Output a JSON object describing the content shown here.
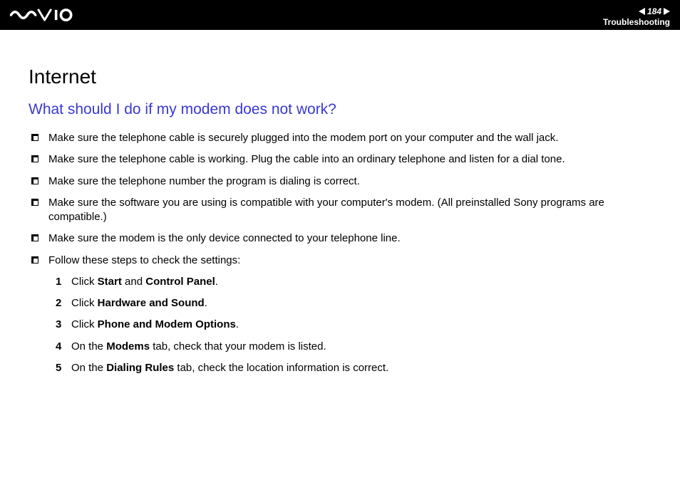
{
  "header": {
    "page_number": "184",
    "section": "Troubleshooting"
  },
  "content": {
    "heading": "Internet",
    "subheading": "What should I do if my modem does not work?",
    "bullets": [
      "Make sure the telephone cable is securely plugged into the modem port on your computer and the wall jack.",
      "Make sure the telephone cable is working. Plug the cable into an ordinary telephone and listen for a dial tone.",
      "Make sure the telephone number the program is dialing is correct.",
      "Make sure the software you are using is compatible with your computer's modem. (All preinstalled Sony programs are compatible.)",
      "Make sure the modem is the only device connected to your telephone line.",
      "Follow these steps to check the settings:"
    ],
    "steps": [
      {
        "num": "1",
        "prefix": "Click ",
        "bold1": "Start",
        "mid": " and ",
        "bold2": "Control Panel",
        "suffix": "."
      },
      {
        "num": "2",
        "prefix": "Click ",
        "bold1": "Hardware and Sound",
        "mid": "",
        "bold2": "",
        "suffix": "."
      },
      {
        "num": "3",
        "prefix": "Click ",
        "bold1": "Phone and Modem Options",
        "mid": "",
        "bold2": "",
        "suffix": "."
      },
      {
        "num": "4",
        "prefix": "On the ",
        "bold1": "Modems",
        "mid": " tab, check that your modem is listed.",
        "bold2": "",
        "suffix": ""
      },
      {
        "num": "5",
        "prefix": "On the ",
        "bold1": "Dialing Rules",
        "mid": " tab, check the location information is correct.",
        "bold2": "",
        "suffix": ""
      }
    ]
  }
}
